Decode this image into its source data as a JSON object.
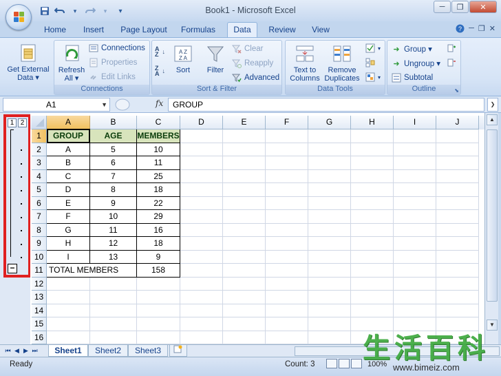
{
  "window": {
    "title": "Book1 - Microsoft Excel",
    "controls": {
      "minimize": "─",
      "maximize": "❐",
      "close": "✕"
    }
  },
  "qat": {
    "save": "💾",
    "undo": "↶",
    "redo": "↷",
    "customize": "▾"
  },
  "tabs": [
    "Home",
    "Insert",
    "Page Layout",
    "Formulas",
    "Data",
    "Review",
    "View"
  ],
  "active_tab": "Data",
  "ribbon": {
    "get_external": {
      "label1": "Get External",
      "label2": "Data ▾"
    },
    "connections_group": {
      "label": "Connections",
      "refresh1": "Refresh",
      "refresh2": "All ▾",
      "connections": "Connections",
      "properties": "Properties",
      "edit_links": "Edit Links"
    },
    "sort_filter_group": {
      "label": "Sort & Filter",
      "sort": "Sort",
      "filter": "Filter",
      "clear": "Clear",
      "reapply": "Reapply",
      "advanced": "Advanced"
    },
    "data_tools_group": {
      "label": "Data Tools",
      "text_to1": "Text to",
      "text_to2": "Columns",
      "remove1": "Remove",
      "remove2": "Duplicates"
    },
    "outline_group": {
      "label": "Outline",
      "group": "Group ▾",
      "ungroup": "Ungroup ▾",
      "subtotal": "Subtotal"
    }
  },
  "formula_bar": {
    "name_box": "A1",
    "fx": "fx",
    "value": "GROUP"
  },
  "outline": {
    "level1": "1",
    "level2": "2",
    "collapse": "−"
  },
  "columns": [
    "A",
    "B",
    "C",
    "D",
    "E",
    "F",
    "G",
    "H",
    "I",
    "J"
  ],
  "rows": [
    "1",
    "2",
    "3",
    "4",
    "5",
    "6",
    "7",
    "8",
    "9",
    "10",
    "11",
    "12",
    "13",
    "14",
    "15",
    "16"
  ],
  "table": {
    "headers": [
      "GROUP",
      "AGE",
      "MEMBERS"
    ],
    "data": [
      [
        "A",
        "5",
        "10"
      ],
      [
        "B",
        "6",
        "11"
      ],
      [
        "C",
        "7",
        "25"
      ],
      [
        "D",
        "8",
        "18"
      ],
      [
        "E",
        "9",
        "22"
      ],
      [
        "F",
        "10",
        "29"
      ],
      [
        "G",
        "11",
        "16"
      ],
      [
        "H",
        "12",
        "18"
      ],
      [
        "I",
        "13",
        "9"
      ]
    ],
    "total_label": "TOTAL MEMBERS",
    "total_value": "158"
  },
  "sheets": [
    "Sheet1",
    "Sheet2",
    "Sheet3"
  ],
  "active_sheet": "Sheet1",
  "status": {
    "ready": "Ready",
    "count": "Count: 3",
    "zoom": "100%"
  },
  "watermark": {
    "cn": "生活百科",
    "url": "www.bimeiz.com"
  },
  "colors": {
    "header_fill": "#d8e4bc",
    "highlight": "#e02020",
    "selected_header": "#f1c15f"
  }
}
